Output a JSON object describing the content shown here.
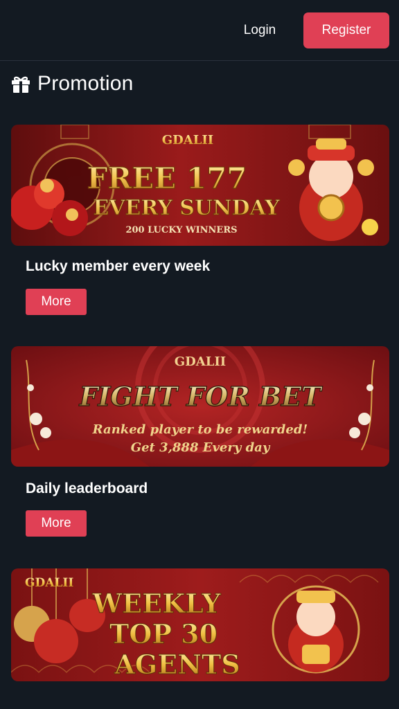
{
  "colors": {
    "background": "#131a22",
    "accent": "#e04055",
    "banner_red": "#8e1a1a",
    "gold": "#f2cd6c"
  },
  "header": {
    "login_label": "Login",
    "register_label": "Register"
  },
  "section": {
    "title": "Promotion",
    "icon": "gift-icon"
  },
  "promos": [
    {
      "banner": {
        "brand": "GDALII",
        "line1": "FREE 177",
        "line2": "EVERY SUNDAY",
        "line3": "200 LUCKY WINNERS"
      },
      "title": "Lucky member every week",
      "more_label": "More"
    },
    {
      "banner": {
        "brand": "GDALII",
        "line1": "FIGHT  FOR BET",
        "line2": "Ranked player to be rewarded!",
        "line3": "Get 3,888 Every day"
      },
      "title": "Daily leaderboard",
      "more_label": "More"
    },
    {
      "banner": {
        "brand": "GDALII",
        "line1": "WEEKLY",
        "line2": "TOP 30",
        "line3": "AGENTS"
      }
    }
  ]
}
